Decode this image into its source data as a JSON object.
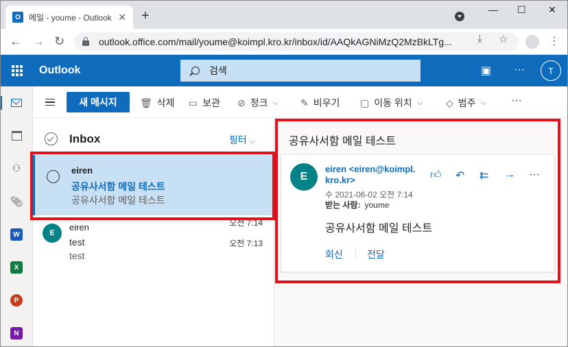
{
  "browser": {
    "tab_title": "메일 - youme - Outlook",
    "url": "outlook.office.com/mail/youme@koimpl.kro.kr/inbox/id/AAQkAGNiMzQ2MzBkLTg...",
    "favicon_letter": "O"
  },
  "app": {
    "brand": "Outlook",
    "search_placeholder": "검색",
    "user_initial": "T"
  },
  "toolbar": {
    "new_message": "새 메시지",
    "delete": "삭제",
    "archive": "보관",
    "sweep_block": "정크",
    "sweep": "비우기",
    "move_to": "이동 위치",
    "categorize": "범주",
    "more": "···"
  },
  "rail": {
    "apps": [
      {
        "letter": "W",
        "color": "#185abd"
      },
      {
        "letter": "X",
        "color": "#107c41"
      },
      {
        "letter": "P",
        "color": "#c43e1c"
      },
      {
        "letter": "N",
        "color": "#7719aa"
      }
    ]
  },
  "list": {
    "folder": "Inbox",
    "filter": "필터",
    "messages": [
      {
        "from": "eiren",
        "subject": "공유사서함 메일 테스트",
        "preview": "공유사서함 메일 테스트",
        "time": "오전 7:14",
        "selected": true
      },
      {
        "from": "eiren",
        "subject": "test",
        "preview": "test",
        "time": "오전 7:13",
        "initial": "E",
        "selected": false
      }
    ]
  },
  "reading": {
    "subject": "공유사서함 메일 테스트",
    "avatar_initial": "E",
    "sender": "eiren <eiren@koimpl.kro.kr>",
    "date": "수 2021-06-02 오전 7:14",
    "to_label": "받는 사람:",
    "to": "youme",
    "body": "공유사서함 메일 테스트",
    "reply": "회신",
    "forward": "전달"
  },
  "colors": {
    "brand_blue": "#0f6cbd",
    "highlight_red": "#e2101b",
    "avatar_teal": "#038387"
  }
}
